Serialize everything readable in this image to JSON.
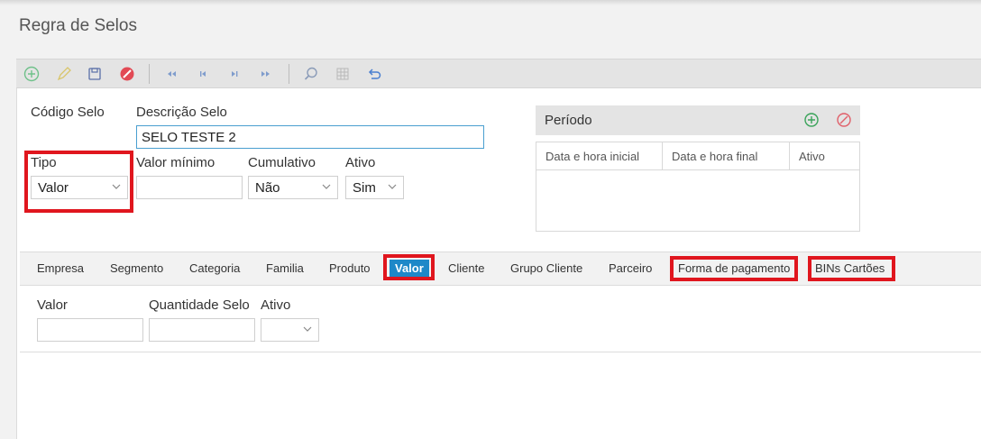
{
  "page": {
    "title": "Regra de Selos"
  },
  "toolbar": {
    "icons": [
      "add-icon",
      "edit-icon",
      "save-icon",
      "cancel-icon",
      "first-record-icon",
      "previous-record-icon",
      "next-record-icon",
      "last-record-icon",
      "search-icon",
      "grid-icon",
      "undo-icon"
    ]
  },
  "form": {
    "codigo_label": "Código Selo",
    "codigo_value": "",
    "descricao_label": "Descrição Selo",
    "descricao_value": "SELO TESTE 2",
    "tipo_label": "Tipo",
    "tipo_value": "Valor",
    "valor_minimo_label": "Valor mínimo",
    "valor_minimo_value": "",
    "cumulativo_label": "Cumulativo",
    "cumulativo_value": "Não",
    "ativo_label": "Ativo",
    "ativo_value": "Sim"
  },
  "periodo": {
    "title": "Período",
    "columns": [
      "Data e hora inicial",
      "Data e hora final",
      "Ativo"
    ]
  },
  "tabs": [
    "Empresa",
    "Segmento",
    "Categoria",
    "Familia",
    "Produto",
    "Valor",
    "Cliente",
    "Grupo Cliente",
    "Parceiro",
    "Forma de pagamento",
    "BINs Cartões"
  ],
  "active_tab": "Valor",
  "detail": {
    "valor_label": "Valor",
    "valor_value": "",
    "quantidade_label": "Quantidade Selo",
    "quantidade_value": "",
    "ativo_label": "Ativo",
    "ativo_value": ""
  },
  "colors": {
    "highlight": "#e0161e",
    "active_tab": "#1e88c8",
    "add_green": "#3aa35a",
    "delete_red": "#e0606a",
    "nav_blue": "#6f8fc4"
  }
}
